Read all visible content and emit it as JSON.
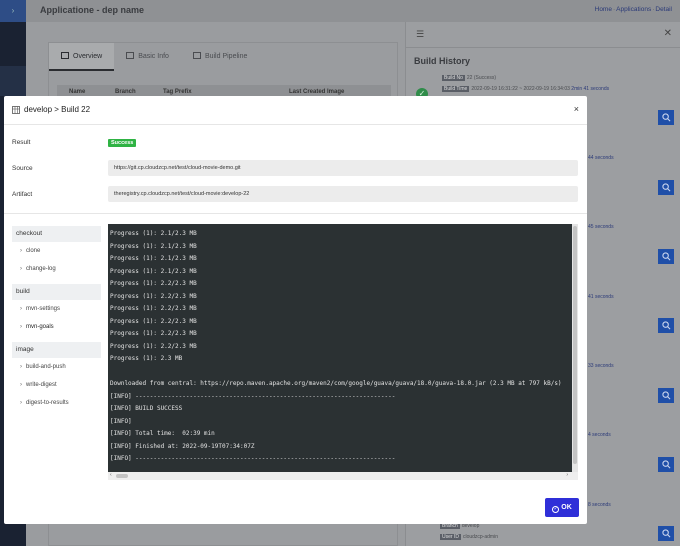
{
  "app": {
    "title": "Applicatione - dep name",
    "breadcrumb": [
      "Home",
      "Applications",
      "Detail"
    ]
  },
  "tabs": [
    {
      "label": "Overview",
      "active": true
    },
    {
      "label": "Basic Info",
      "active": false
    },
    {
      "label": "Build Pipeline",
      "active": false
    }
  ],
  "table": {
    "columns": [
      "Name",
      "Branch",
      "Tag Prefix",
      "Last Created Image"
    ]
  },
  "build_history": {
    "title": "Build History",
    "first_item": {
      "build_no_label": "Build No",
      "build_no_value": "22 (Success)",
      "build_time_label": "Build Time",
      "build_time_value": "2022-09-19 16:31:22 ~ 2022-09-19 16:34:03",
      "duration": "2min 41 seconds"
    },
    "durations": [
      "44 seconds",
      "45 seconds",
      "41 seconds",
      "33 seconds",
      "4 seconds",
      "8 seconds"
    ],
    "last_item": {
      "branch_label": "Branch",
      "branch_value": "develop",
      "user_label": "User ID",
      "user_value": "cloudzcp-admin"
    }
  },
  "modal": {
    "title": "develop > Build 22",
    "result_label": "Result",
    "result_value": "Success",
    "source_label": "Source",
    "source_value": "https://git.cp.cloudzcp.net/test/cloud-movie-demo.git",
    "artifact_label": "Artifact",
    "artifact_value": "theregistry.cp.cloudzcp.net/test/cloud-movie:develop-22",
    "ok_label": "OK",
    "stages": [
      {
        "name": "checkout",
        "steps": [
          {
            "name": "clone",
            "bold": false
          },
          {
            "name": "change-log",
            "bold": false
          }
        ]
      },
      {
        "name": "build",
        "steps": [
          {
            "name": "mvn-settings",
            "bold": false
          },
          {
            "name": "mvn-goals",
            "bold": true
          }
        ]
      },
      {
        "name": "image",
        "steps": [
          {
            "name": "build-and-push",
            "bold": false
          },
          {
            "name": "write-digest",
            "bold": false
          },
          {
            "name": "digest-to-results",
            "bold": false
          }
        ]
      }
    ],
    "console_lines": [
      "Progress (1): 2.1/2.3 MB",
      "Progress (1): 2.1/2.3 MB",
      "Progress (1): 2.1/2.3 MB",
      "Progress (1): 2.1/2.3 MB",
      "Progress (1): 2.2/2.3 MB",
      "Progress (1): 2.2/2.3 MB",
      "Progress (1): 2.2/2.3 MB",
      "Progress (1): 2.2/2.3 MB",
      "Progress (1): 2.2/2.3 MB",
      "Progress (1): 2.2/2.3 MB",
      "Progress (1): 2.3 MB",
      "",
      "Downloaded from central: https://repo.maven.apache.org/maven2/com/google/guava/guava/18.0/guava-18.0.jar (2.3 MB at 797 kB/s)",
      "[INFO] ------------------------------------------------------------------------",
      "[INFO] BUILD SUCCESS",
      "[INFO]",
      "[INFO] Total time:  02:39 min",
      "[INFO] Finished at: 2022-09-19T07:34:07Z",
      "[INFO] ------------------------------------------------------------------------"
    ]
  }
}
